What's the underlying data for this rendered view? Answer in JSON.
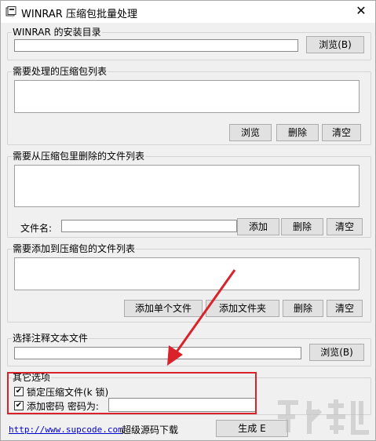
{
  "window": {
    "title": "WINRAR 压缩包批量处理"
  },
  "install_dir": {
    "legend": "WINRAR 的安装目录",
    "value": "",
    "browse_label": "浏览(B)"
  },
  "archive_list": {
    "legend": "需要处理的压缩包列表",
    "browse_label": "浏览",
    "delete_label": "删除",
    "clear_label": "清空"
  },
  "delete_list": {
    "legend": "需要从压缩包里删除的文件列表",
    "filename_label": "文件名:",
    "filename_value": "",
    "add_label": "添加",
    "delete_label": "删除",
    "clear_label": "清空"
  },
  "add_list": {
    "legend": "需要添加到压缩包的文件列表",
    "add_single_label": "添加单个文件",
    "add_folder_label": "添加文件夹",
    "delete_label": "删除",
    "clear_label": "清空"
  },
  "comment_file": {
    "legend": "选择注释文本文件",
    "value": "",
    "browse_label": "浏览(B)"
  },
  "other_options": {
    "legend": "其它选项",
    "lock_label": "锁定压缩文件(k 锁)",
    "lock_checked": true,
    "password_label": "添加密码  密码为:",
    "password_checked": true,
    "password_value": ""
  },
  "footer": {
    "link_text": "http://www.supcode.com",
    "download_label": "超级源码下载",
    "generate_label": "生成 E"
  },
  "colors": {
    "highlight": "#d9222a",
    "arrow": "#d9222a",
    "link": "#0000cc"
  }
}
